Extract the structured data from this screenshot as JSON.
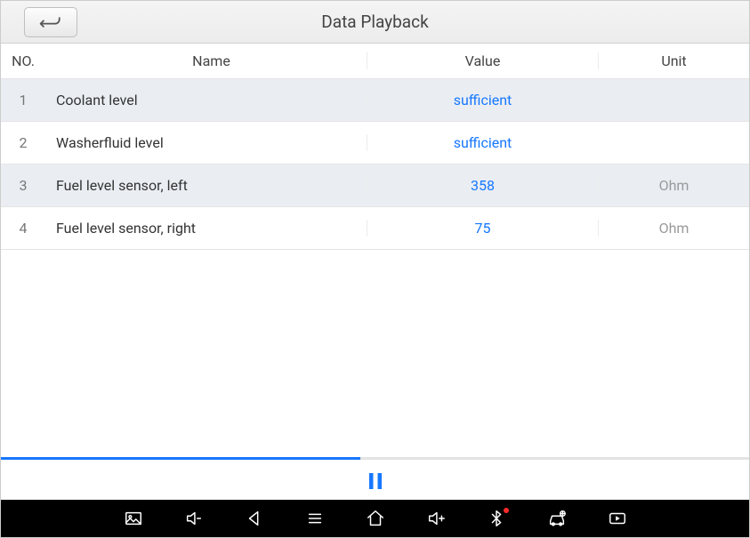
{
  "title": "Data Playback",
  "header": {
    "no": "NO.",
    "name": "Name",
    "value": "Value",
    "unit": "Unit"
  },
  "rows": [
    {
      "no": "1",
      "name": "Coolant level",
      "value": "sufficient",
      "unit": ""
    },
    {
      "no": "2",
      "name": "Washerfluid level",
      "value": "sufficient",
      "unit": ""
    },
    {
      "no": "3",
      "name": "Fuel level sensor, left",
      "value": "358",
      "unit": "Ohm"
    },
    {
      "no": "4",
      "name": "Fuel level sensor, right",
      "value": "75",
      "unit": "Ohm"
    }
  ],
  "playback": {
    "progressPercent": 48,
    "state": "playing"
  },
  "nav": {
    "items": [
      "image",
      "vol-down",
      "back",
      "menu",
      "home",
      "vol-up",
      "bluetooth",
      "car-plus",
      "video"
    ],
    "bluetoothAlert": true
  }
}
